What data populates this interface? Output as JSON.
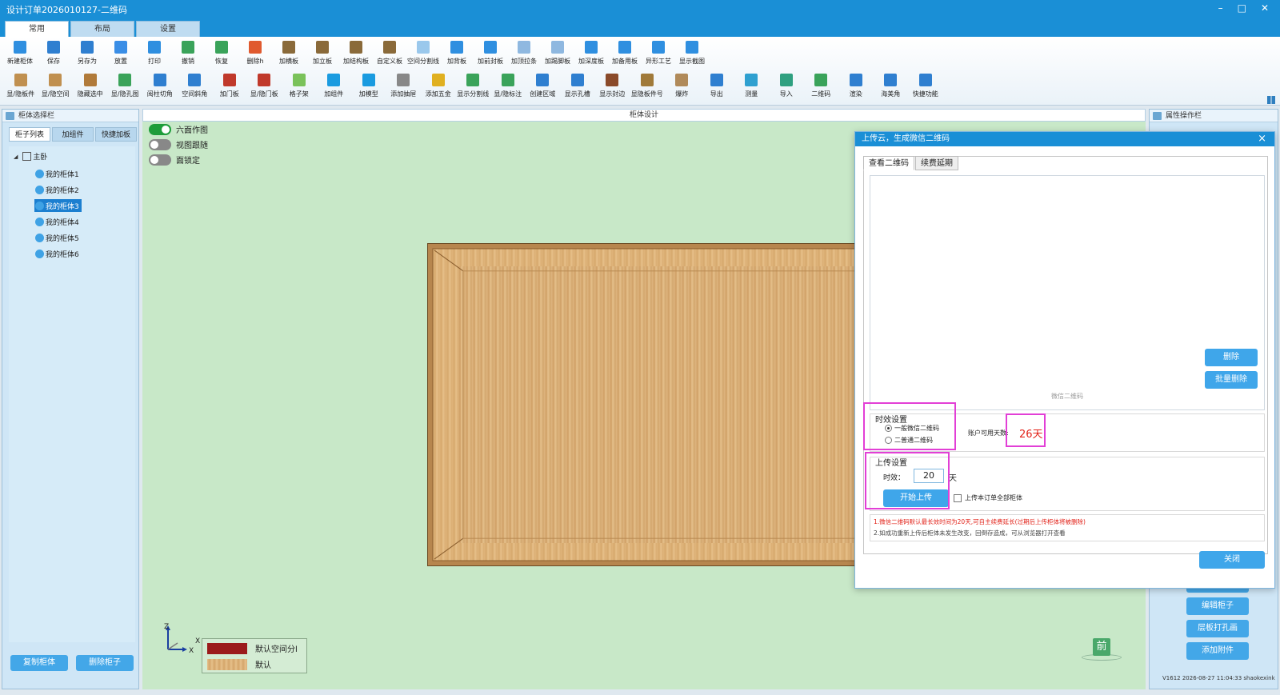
{
  "window": {
    "title": "设计订单2026010127-二维码"
  },
  "menu_tabs": [
    "常用",
    "布局",
    "设置"
  ],
  "toolbar": {
    "row1": [
      {
        "label": "新建柜体",
        "color": "#2f8fe0"
      },
      {
        "label": "保存",
        "color": "#2f7fd0"
      },
      {
        "label": "另存为",
        "color": "#2f7fd0"
      },
      {
        "label": "放置",
        "color": "#3a8ee6"
      },
      {
        "label": "打印",
        "color": "#2f8fe0"
      },
      {
        "label": "撤销",
        "color": "#3aa35a"
      },
      {
        "label": "恢复",
        "color": "#3aa35a"
      },
      {
        "label": "删除h",
        "color": "#e05a2f"
      },
      {
        "label": "加横板",
        "color": "#8a6a3a"
      },
      {
        "label": "加立板",
        "color": "#8a6a3a"
      },
      {
        "label": "加结构板",
        "color": "#8a6a3a"
      },
      {
        "label": "自定义板",
        "color": "#8a6a3a"
      },
      {
        "label": "空间分割线",
        "color": "#9ac8ec"
      },
      {
        "label": "加背板",
        "color": "#2f8fe0"
      },
      {
        "label": "加前封板",
        "color": "#2f8fe0"
      },
      {
        "label": "加顶拉条",
        "color": "#8fb8e0"
      },
      {
        "label": "加踢脚板",
        "color": "#8fb8e0"
      },
      {
        "label": "加深度板",
        "color": "#2f8fe0"
      },
      {
        "label": "加备用板",
        "color": "#2f8fe0"
      },
      {
        "label": "异形工艺",
        "color": "#2f8fe0"
      },
      {
        "label": "显示截图",
        "color": "#2f8fe0"
      }
    ],
    "row2": [
      {
        "label": "显/隐板件",
        "color": "#c09050"
      },
      {
        "label": "显/隐空间",
        "color": "#c09050"
      },
      {
        "label": "隐藏选中",
        "color": "#b07a3a"
      },
      {
        "label": "显/隐孔图",
        "color": "#3aa35a"
      },
      {
        "label": "阅柱切角",
        "color": "#2f7fd0"
      },
      {
        "label": "空间斜角",
        "color": "#2f7fd0"
      },
      {
        "label": "加门板",
        "color": "#c0392b"
      },
      {
        "label": "显/隐门板",
        "color": "#c0392b"
      },
      {
        "label": "格子架",
        "color": "#7ac25a"
      },
      {
        "label": "加组件",
        "color": "#1a9be0"
      },
      {
        "label": "加模型",
        "color": "#1a9be0"
      },
      {
        "label": "添加抽屉",
        "color": "#888888"
      },
      {
        "label": "添加五金",
        "color": "#e0b020"
      },
      {
        "label": "显示分割线",
        "color": "#3aa35a"
      },
      {
        "label": "显/隐标注",
        "color": "#3aa35a"
      },
      {
        "label": "创建区域",
        "color": "#2f7fd0"
      },
      {
        "label": "显示孔槽",
        "color": "#2f7fd0"
      },
      {
        "label": "显示封边",
        "color": "#8a4a2a"
      },
      {
        "label": "显隐板件号",
        "color": "#a07a3a"
      },
      {
        "label": "爆炸",
        "color": "#b08a5a"
      },
      {
        "label": "导出",
        "color": "#2f7fd0"
      },
      {
        "label": "测量",
        "color": "#2fa0d0"
      },
      {
        "label": "导入",
        "color": "#2fa080"
      },
      {
        "label": "二维码",
        "color": "#3aa35a"
      },
      {
        "label": "渲染",
        "color": "#2f7fd0"
      },
      {
        "label": "海美角",
        "color": "#2f7fd0"
      },
      {
        "label": "快捷功能",
        "color": "#2f7fd0"
      }
    ]
  },
  "left_panel": {
    "title": "柜体选择栏",
    "tabs": [
      "柜子列表",
      "加组件",
      "快捷加板"
    ],
    "tree": {
      "root": "主卧",
      "items": [
        "我的柜体1",
        "我的柜体2",
        "我的柜体3",
        "我的柜体4",
        "我的柜体5",
        "我的柜体6"
      ],
      "selected_index": 2
    },
    "buttons": {
      "copy": "复制柜体",
      "delete": "删除柜子"
    }
  },
  "canvas": {
    "title": "柜体设计",
    "toggles": [
      {
        "label": "六面作图",
        "on": true
      },
      {
        "label": "视图跟随",
        "on": false
      },
      {
        "label": "面锁定",
        "on": false
      }
    ],
    "axes": {
      "z": "Z",
      "x": "X",
      "x2": "X"
    },
    "legend": [
      {
        "label": "默认空间分l",
        "color": "#9b1b1b"
      },
      {
        "label": "默认",
        "color": "#e0b47e"
      }
    ],
    "view_label": "前"
  },
  "right_panel": {
    "title": "属性操作栏",
    "buttons": [
      "编辑打孔",
      "编辑柜子",
      "层板打孔画",
      "添加附件"
    ],
    "version": "V1612 2026-08-27 11:04:33 shaokexink"
  },
  "dialog": {
    "title": "上传云，生成微信二维码",
    "close_icon": "×",
    "tabs": [
      "查看二维码",
      "续费延期"
    ],
    "qr_caption": "微信二维码",
    "delete_btn": "删除",
    "batch_delete_btn": "批量删除",
    "validity": {
      "title": "时效设置",
      "options": [
        "一般微信二维码",
        "二普通二维码"
      ],
      "selected": 0,
      "days_label": "账户可用天数:",
      "days_value": "26天"
    },
    "upload": {
      "title": "上传设置",
      "duration_label": "时效：",
      "duration_value": "20",
      "unit": "天",
      "start_btn": "开始上传",
      "checkbox_label": "上传本订单全部柜体"
    },
    "notes": [
      "1.微信二维码默认最长效时间为20天,可自主续费延长(过期后上传柜体将被删除)",
      "2.如成功重新上传后柜体未发生改变，回倒存造成，可从浏览器打开查看"
    ],
    "close_btn": "关闭"
  }
}
